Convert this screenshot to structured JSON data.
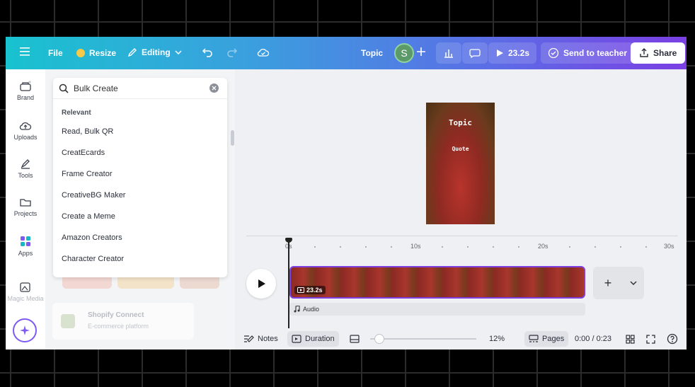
{
  "topbar": {
    "file_label": "File",
    "resize_label": "Resize",
    "editing_label": "Editing",
    "title": "Topic",
    "avatar_initial": "S",
    "play_duration": "23.2s",
    "send_label": "Send to teacher",
    "share_label": "Share"
  },
  "rail": {
    "items": [
      {
        "label": "Brand",
        "icon": "brand-icon"
      },
      {
        "label": "Uploads",
        "icon": "cloud-upload-icon"
      },
      {
        "label": "Tools",
        "icon": "pen-tool-icon"
      },
      {
        "label": "Projects",
        "icon": "folder-icon"
      },
      {
        "label": "Apps",
        "icon": "apps-grid-icon"
      },
      {
        "label": "Magic Media",
        "icon": "magic-media-icon"
      }
    ]
  },
  "search": {
    "value": "Bulk Create",
    "section_label": "Relevant",
    "options": [
      "Read, Bulk QR",
      "CreatEcards",
      "Frame Creator",
      "CreativeBG Maker",
      "Create a Meme",
      "Amazon Creators",
      "Character Creator"
    ]
  },
  "panel_background": {
    "app_title": "Shopify Connect",
    "app_subtitle": "E-commerce platform"
  },
  "design": {
    "title": "Topic",
    "subtitle": "Quote"
  },
  "timeline": {
    "ticks": [
      "0s",
      "10s",
      "20s",
      "30s"
    ],
    "clip_duration": "23.2s",
    "audio_label": "Audio"
  },
  "bottombar": {
    "notes_label": "Notes",
    "duration_label": "Duration",
    "zoom": "12%",
    "pages_label": "Pages",
    "time": "0:00 / 0:23"
  }
}
